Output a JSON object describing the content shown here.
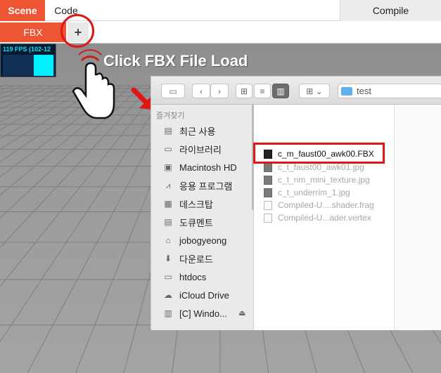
{
  "menu": {
    "scene": "Scene",
    "code": "Code",
    "compile": "Compile"
  },
  "tabs": {
    "fbx": "FBX",
    "add": "+"
  },
  "stats": {
    "fps": "119 FPS (102-12"
  },
  "hint": "Click FBX File Load",
  "dialog": {
    "current_folder": "test",
    "sidebar_heading": "즐겨찾기",
    "sidebar_items": [
      {
        "label": "최근 사용",
        "icon": "clock-icon"
      },
      {
        "label": "라이브러리",
        "icon": "folder-icon"
      },
      {
        "label": "Macintosh HD",
        "icon": "hard-drive-icon"
      },
      {
        "label": "응용 프로그램",
        "icon": "applications-icon"
      },
      {
        "label": "데스크탑",
        "icon": "desktop-icon"
      },
      {
        "label": "도큐멘트",
        "icon": "documents-icon"
      },
      {
        "label": "jobogyeong",
        "icon": "home-icon"
      },
      {
        "label": "다운로드",
        "icon": "download-icon"
      },
      {
        "label": "htdocs",
        "icon": "folder-icon"
      },
      {
        "label": "iCloud Drive",
        "icon": "cloud-icon"
      },
      {
        "label": "[C] Windo...",
        "icon": "disk-icon"
      }
    ],
    "files": [
      {
        "name": "c_m_faust00_awk00.FBX",
        "selected": true
      },
      {
        "name": "c_t_faust00_awk01.jpg",
        "selected": false
      },
      {
        "name": "c_t_rim_mini_texture.jpg",
        "selected": false
      },
      {
        "name": "c_t_underrim_1.jpg",
        "selected": false
      },
      {
        "name": "Compiled-U....shader.frag",
        "selected": false
      },
      {
        "name": "Compiled-U...ader.vertex",
        "selected": false
      }
    ]
  },
  "colors": {
    "accent": "#ee5533",
    "annotation": "#e01515",
    "fps": "#00e8ff"
  }
}
